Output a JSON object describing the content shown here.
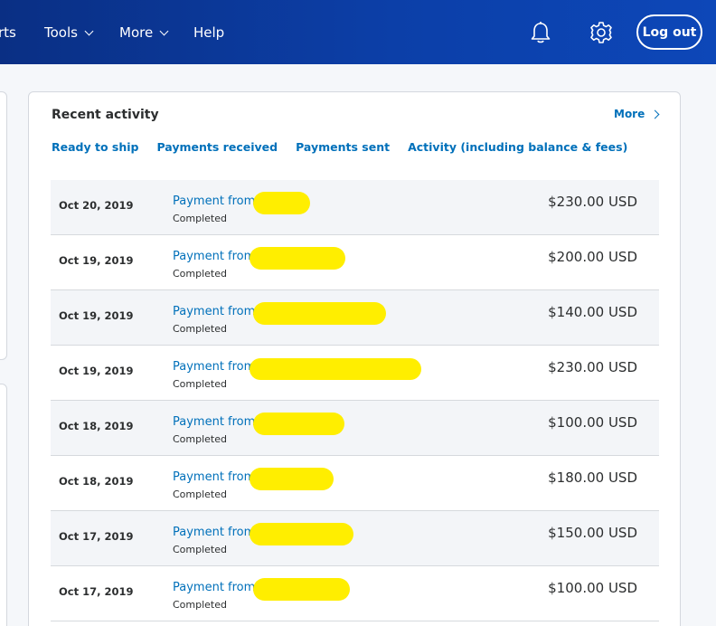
{
  "header": {
    "nav": [
      {
        "label": "rts",
        "has_chevron": false
      },
      {
        "label": "Tools",
        "has_chevron": true
      },
      {
        "label": "More",
        "has_chevron": true
      },
      {
        "label": "Help",
        "has_chevron": false
      }
    ],
    "logout_label": "Log out",
    "icons": [
      "bell-icon",
      "gear-icon"
    ]
  },
  "activity": {
    "title": "Recent activity",
    "more_label": "More",
    "tabs": [
      "Ready to ship",
      "Payments received",
      "Payments sent",
      "Activity (including balance & fees)"
    ],
    "rows": [
      {
        "date": "Oct 20, 2019",
        "description": "Payment from",
        "status": "Completed",
        "amount": "$230.00 USD"
      },
      {
        "date": "Oct 19, 2019",
        "description": "Payment from",
        "status": "Completed",
        "amount": "$200.00 USD"
      },
      {
        "date": "Oct 19, 2019",
        "description": "Payment from",
        "status": "Completed",
        "amount": "$140.00 USD"
      },
      {
        "date": "Oct 19, 2019",
        "description": "Payment from",
        "status": "Completed",
        "amount": "$230.00 USD"
      },
      {
        "date": "Oct 18, 2019",
        "description": "Payment from",
        "status": "Completed",
        "amount": "$100.00 USD"
      },
      {
        "date": "Oct 18, 2019",
        "description": "Payment from",
        "status": "Completed",
        "amount": "$180.00 USD"
      },
      {
        "date": "Oct 17, 2019",
        "description": "Payment from",
        "status": "Completed",
        "amount": "$150.00 USD"
      },
      {
        "date": "Oct 17, 2019",
        "description": "Payment from",
        "status": "Completed",
        "amount": "$100.00 USD"
      }
    ]
  },
  "colors": {
    "header": "#0c3fa8",
    "link": "#0070ba",
    "redaction": "#ffee00",
    "row_alt": "#f3f5f8"
  }
}
